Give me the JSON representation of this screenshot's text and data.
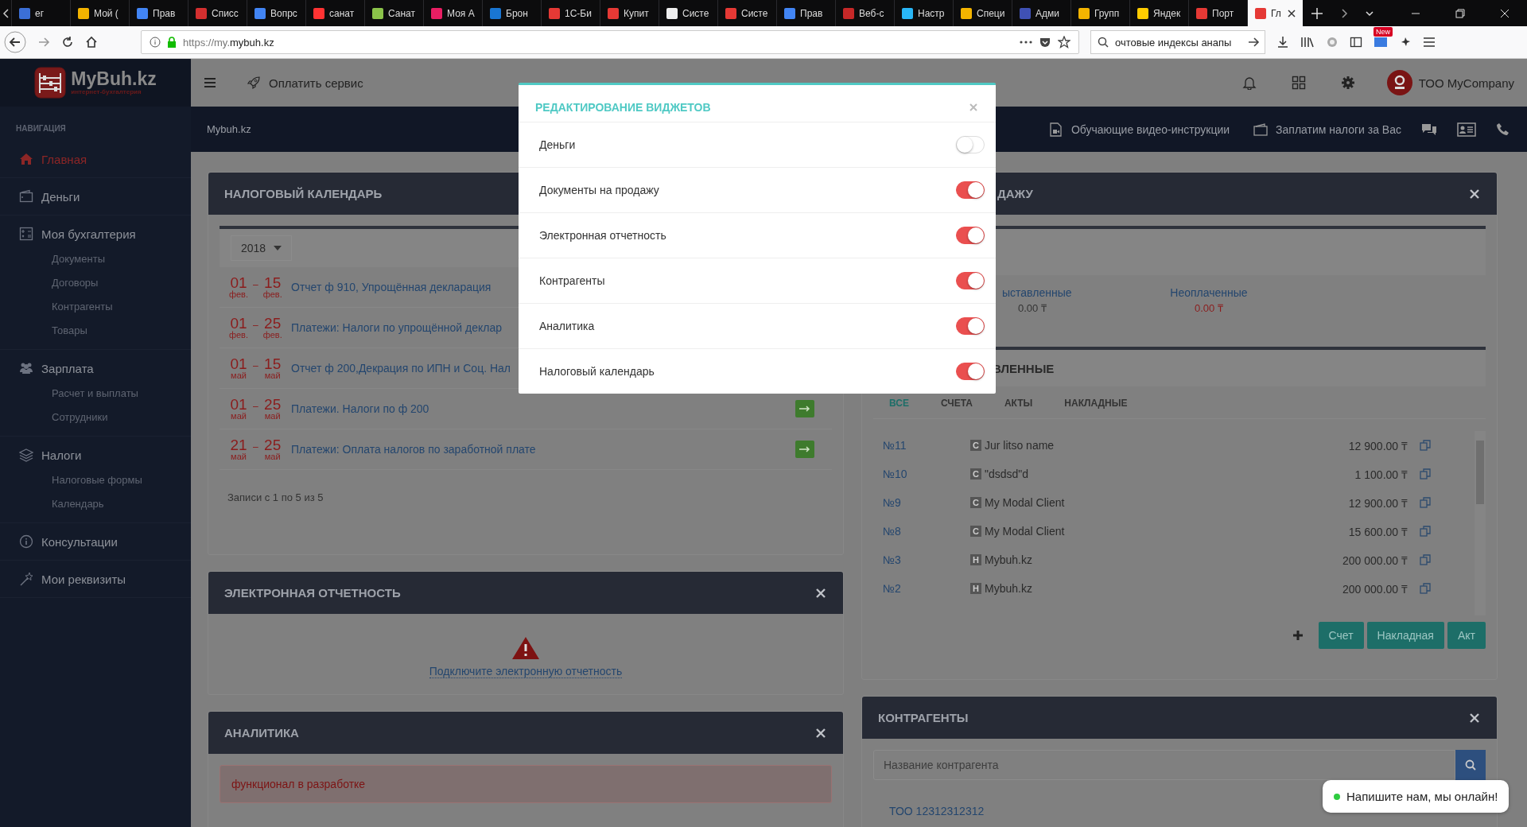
{
  "browser": {
    "tabs": [
      {
        "label": "ег",
        "selected": false,
        "color": "#3b6fd6"
      },
      {
        "label": "Мой (",
        "selected": false,
        "color": "#f4b400"
      },
      {
        "label": "Прав",
        "selected": false,
        "color": "#4285f4"
      },
      {
        "label": "Списс",
        "selected": false,
        "color": "#d32f2f"
      },
      {
        "label": "Вопрс",
        "selected": false,
        "color": "#4285f4"
      },
      {
        "label": "санат",
        "selected": false,
        "color": "#ff3333"
      },
      {
        "label": "Санат",
        "selected": false,
        "color": "#8bc34a"
      },
      {
        "label": "Моя А",
        "selected": false,
        "color": "#e91e63"
      },
      {
        "label": "Брон",
        "selected": false,
        "color": "#1976d2"
      },
      {
        "label": "1С-Би",
        "selected": false,
        "color": "#e53935"
      },
      {
        "label": "Купит",
        "selected": false,
        "color": "#e53935"
      },
      {
        "label": "Систе",
        "selected": false,
        "color": "#eeeeee"
      },
      {
        "label": "Систе",
        "selected": false,
        "color": "#e53935"
      },
      {
        "label": "Прав",
        "selected": false,
        "color": "#4285f4"
      },
      {
        "label": "Веб-с",
        "selected": false,
        "color": "#c62828"
      },
      {
        "label": "Настр",
        "selected": false,
        "color": "#29b6f6"
      },
      {
        "label": "Специ",
        "selected": false,
        "color": "#f4b400"
      },
      {
        "label": "Адми",
        "selected": false,
        "color": "#3f51b5"
      },
      {
        "label": "Групп",
        "selected": false,
        "color": "#f4b400"
      },
      {
        "label": "Яндек",
        "selected": false,
        "color": "#ffcc00"
      },
      {
        "label": "Порт",
        "selected": false,
        "color": "#e53935"
      },
      {
        "label": "Гл",
        "selected": true,
        "color": "#e53935"
      }
    ],
    "url": "https://my.**mybuh.kz**",
    "search": "очтовые индексы анапы",
    "badge": "New"
  },
  "sidebar": {
    "logo": "MyBuh.kz",
    "tagline": "интернет-бухгалтерия",
    "section": "НАВИГАЦИЯ",
    "items": [
      {
        "label": "Главная",
        "selected": true
      },
      {
        "label": "Деньги",
        "selected": false
      },
      {
        "label": "Моя бухгалтерия",
        "selected": false,
        "children": [
          {
            "label": "Документы"
          },
          {
            "label": "Договоры"
          },
          {
            "label": "Контрагенты"
          },
          {
            "label": "Товары"
          }
        ]
      },
      {
        "label": "Зарплата",
        "selected": false,
        "children": [
          {
            "label": "Расчет и выплаты"
          },
          {
            "label": "Сотрудники"
          }
        ]
      },
      {
        "label": "Налоги",
        "selected": false,
        "children": [
          {
            "label": "Налоговые формы"
          },
          {
            "label": "Календарь"
          }
        ]
      },
      {
        "label": "Консультации",
        "selected": false
      },
      {
        "label": "Мои реквизиты",
        "selected": false
      }
    ]
  },
  "topbar": {
    "pay_link": "Оплатить сервис",
    "account": "ТОО MyCompany"
  },
  "subbar": {
    "breadcrumb": "Mybuh.kz",
    "links": [
      "Обучающие видео-инструкции",
      "Заплатим налоги за Вас"
    ]
  },
  "tax_calendar": {
    "title": "НАЛОГОВЫЙ КАЛЕНДАРЬ",
    "year": "2018",
    "rows": [
      {
        "from": "01",
        "from_month": "фев.",
        "sep": "–",
        "to": "15",
        "to_month": "фев.",
        "text": "Отчет ф 910, Упрощённая декларация",
        "arrow": false
      },
      {
        "from": "01",
        "from_month": "фев.",
        "sep": "–",
        "to": "25",
        "to_month": "фев.",
        "text": "Платежи: Налоги по упрощённой деклар",
        "arrow": false
      },
      {
        "from": "01",
        "from_month": "май",
        "sep": "–",
        "to": "15",
        "to_month": "май",
        "text": "Отчет ф 200,Декрация по ИПН и Соц. Нал",
        "arrow": false
      },
      {
        "from": "01",
        "from_month": "май",
        "sep": "–",
        "to": "25",
        "to_month": "май",
        "text": "Платежи. Налоги по ф 200",
        "arrow": true
      },
      {
        "from": "21",
        "from_month": "май",
        "sep": "–",
        "to": "25",
        "to_month": "май",
        "text": "Платежи: Оплата налогов по заработной плате",
        "arrow": true
      }
    ],
    "footer": "Записи с 1 по 5 из 5"
  },
  "e_reporting": {
    "title": "ЭЛЕКТРОННАЯ ОТЧЕТНОСТЬ",
    "link": "Подключите электронную отчетность"
  },
  "analytics": {
    "title": "АНАЛИТИКА",
    "alert": "функционал в разработке"
  },
  "sales_docs": {
    "title": "ДАЖУ",
    "stats": [
      {
        "label": "ыставленные",
        "value": "0.00 ₸",
        "kind": "neutral"
      },
      {
        "label": "Неоплаченные",
        "value": "0.00 ₸",
        "kind": "due"
      }
    ],
    "section": "ВЛЕННЫЕ",
    "tabs": [
      {
        "label": "ВСЕ",
        "selected": true
      },
      {
        "label": "СЧЕТА",
        "selected": false
      },
      {
        "label": "АКТЫ",
        "selected": false
      },
      {
        "label": "НАКЛАДНЫЕ",
        "selected": false
      }
    ],
    "rows": [
      {
        "number": "№11",
        "type": "C",
        "client": "Jur litso name",
        "amount": "12 900.00 ₸"
      },
      {
        "number": "№10",
        "type": "C",
        "client": "\"dsdsd\"d",
        "amount": "1 100.00 ₸"
      },
      {
        "number": "№9",
        "type": "C",
        "client": "My Modal Client",
        "amount": "12 900.00 ₸"
      },
      {
        "number": "№8",
        "type": "C",
        "client": "My Modal Client",
        "amount": "15 600.00 ₸"
      },
      {
        "number": "№3",
        "type": "H",
        "client": "Mybuh.kz",
        "amount": "200 000.00 ₸"
      },
      {
        "number": "№2",
        "type": "H",
        "client": "Mybuh.kz",
        "amount": "200 000.00 ₸"
      }
    ],
    "buttons": [
      "Счет",
      "Накладная",
      "Акт"
    ]
  },
  "counterparties": {
    "title": "КОНТРАГЕНТЫ",
    "placeholder": "Название контрагента",
    "rows": [
      "ТОО 12312312312"
    ]
  },
  "chat": {
    "text": "Напишите нам, мы онлайн!"
  },
  "modal": {
    "title": "РЕДАКТИРОВАНИЕ ВИДЖЕТОВ",
    "items": [
      {
        "label": "Деньги",
        "on": false
      },
      {
        "label": "Документы на продажу",
        "on": true
      },
      {
        "label": "Электронная отчетность",
        "on": true
      },
      {
        "label": "Контрагенты",
        "on": true
      },
      {
        "label": "Аналитика",
        "on": true
      },
      {
        "label": "Налоговый календарь",
        "on": true
      }
    ]
  }
}
